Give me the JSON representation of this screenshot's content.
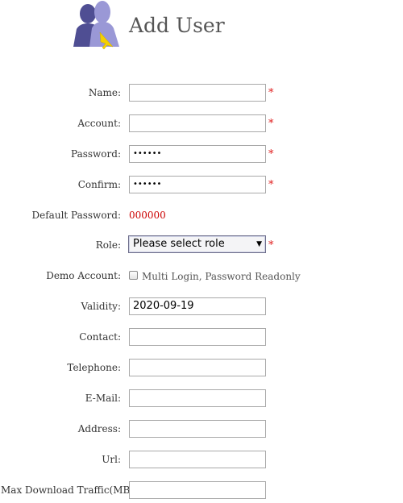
{
  "header": {
    "title": "Add User",
    "icon": "users-add-icon"
  },
  "form": {
    "name": {
      "label": "Name:",
      "value": "",
      "required": "*"
    },
    "account": {
      "label": "Account:",
      "value": "",
      "required": "*"
    },
    "password": {
      "label": "Password:",
      "value": "••••••",
      "required": "*"
    },
    "confirm": {
      "label": "Confirm:",
      "value": "••••••",
      "required": "*"
    },
    "default_password": {
      "label": "Default Password:",
      "value": "000000"
    },
    "role": {
      "label": "Role:",
      "selected": "Please select role",
      "required": "*"
    },
    "demo_account": {
      "label": "Demo Account:",
      "option": "Multi Login, Password Readonly",
      "checked": false
    },
    "validity": {
      "label": "Validity:",
      "value": "2020-09-19"
    },
    "contact": {
      "label": "Contact:",
      "value": ""
    },
    "telephone": {
      "label": "Telephone:",
      "value": ""
    },
    "email": {
      "label": "E-Mail:",
      "value": ""
    },
    "address": {
      "label": "Address:",
      "value": ""
    },
    "url": {
      "label": "Url:",
      "value": ""
    },
    "max_download": {
      "label": "Max Download Traffic(MB)：",
      "value": ""
    }
  },
  "colors": {
    "required": "#e02020",
    "default_password_value": "#cc0000",
    "icon_back": "#4f4e93",
    "icon_front": "#9a98d6",
    "cursor": "#f5d000"
  }
}
